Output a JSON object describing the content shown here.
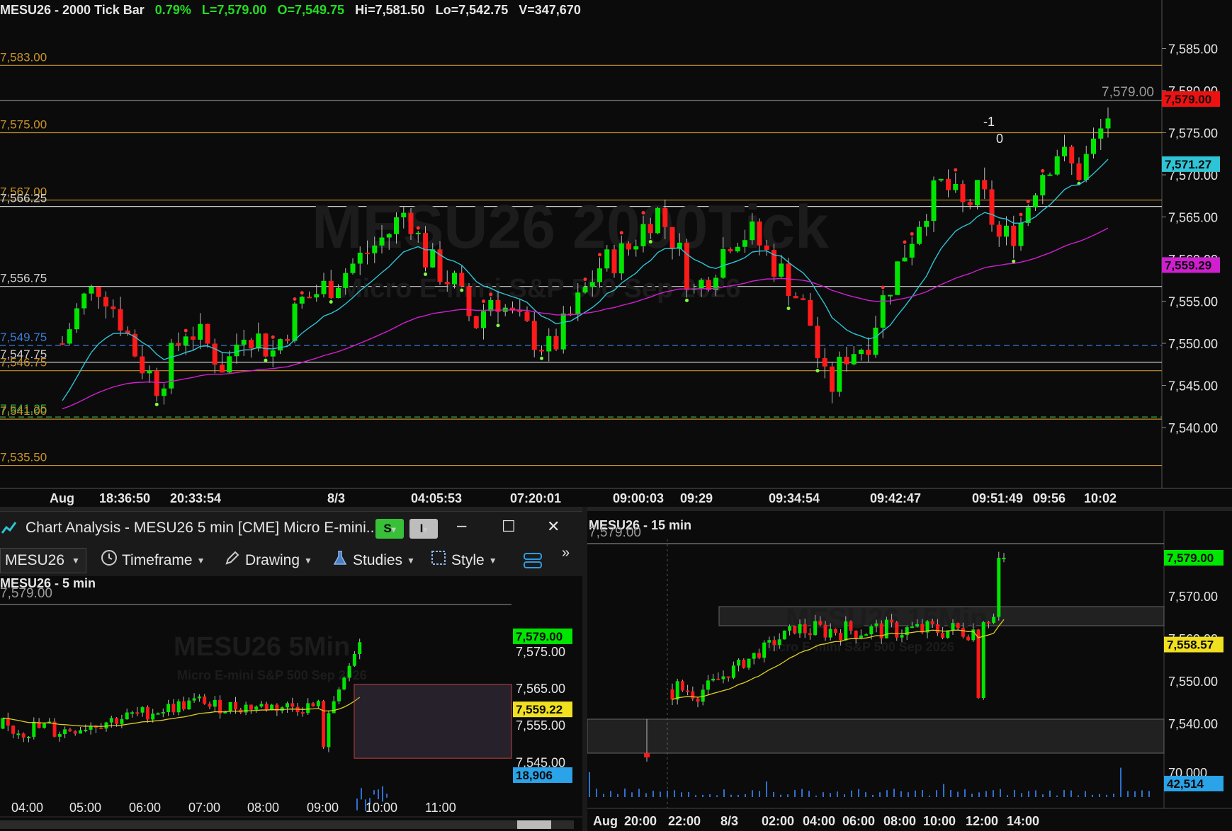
{
  "main_chart": {
    "symbol": "MESU26 - 2000 Tick Bar",
    "change": "0.79%",
    "last": "L=7,579.00",
    "open": "O=7,549.75",
    "high": "Hi=7,581.50",
    "low": "Lo=7,542.75",
    "volume": "V=347,670",
    "watermark_big": "MESU26 2000Tick",
    "watermark_small": "Micro E-mini S&P 500 Sep 2026",
    "y_ticks": [
      "7,585.00",
      "7,580.00",
      "7,575.00",
      "7,570.00",
      "7,565.00",
      "7,560.00",
      "7,555.00",
      "7,550.00",
      "7,545.00",
      "7,540.00"
    ],
    "x_ticks": [
      "Aug",
      "18:36:50",
      "20:33:54",
      "8/3",
      "04:05:53",
      "07:20:01",
      "09:00:03",
      "09:29",
      "09:34:54",
      "09:42:47",
      "09:51:49",
      "09:56",
      "10:02"
    ],
    "level_labels": [
      "7,583.00",
      "7,575.00",
      "7,567.00",
      "7,566.25",
      "7,556.75",
      "7,549.75",
      "7,547.75",
      "7,546.75",
      "7,541.25",
      "7,541.00",
      "7,535.50"
    ],
    "last_price_tag": "7,579.00",
    "last_price_ghost": "7,579.00",
    "ema_fast_tag": "7,571.27",
    "ema_slow_tag": "7,559.29",
    "order_marks": [
      "-1",
      "0"
    ]
  },
  "chart_analysis_window": {
    "title": "Chart Analysis - MESU26 5 min [CME] Micro E-mini...",
    "btn_s": "S",
    "btn_i": "I",
    "minimize": "‒",
    "maximize": "☐",
    "close": "✕",
    "symbol_select": "MESU26",
    "toolbar": {
      "timeframe": "Timeframe",
      "drawing": "Drawing",
      "studies": "Studies",
      "style": "Style",
      "more": "»"
    }
  },
  "chart_5min": {
    "title": "MESU26 - 5 min",
    "ghost_price": "7,579.00",
    "watermark": "MESU26 5Min",
    "watermark_small": "Micro E-mini S&P 500 Sep 2026",
    "y_ticks": [
      "7,575.00",
      "7,565.00",
      "7,555.00",
      "7,545.00"
    ],
    "last_tag": "7,579.00",
    "ma_tag": "7,559.22",
    "volume_tag": "18,906",
    "x_ticks": [
      "04:00",
      "05:00",
      "06:00",
      "07:00",
      "08:00",
      "09:00",
      "10:00",
      "11:00"
    ]
  },
  "chart_15min": {
    "title": "MESU26 - 15 min",
    "ghost_price": "7,579.00",
    "watermark": "MESU26 15Min",
    "watermark_small": "Micro E-mini S&P 500 Sep 2026",
    "y_ticks": [
      "7,570.00",
      "7,560.00",
      "7,550.00",
      "7,540.00"
    ],
    "vol_tick": "70,000",
    "last_tag": "7,579.00",
    "ma_tag": "7,558.57",
    "volume_tag": "42,514",
    "x_ticks": [
      "Aug",
      "20:00",
      "22:00",
      "8/3",
      "02:00",
      "04:00",
      "06:00",
      "08:00",
      "10:00",
      "12:00",
      "14:00"
    ]
  },
  "colors": {
    "up": "#00e600",
    "down": "#ff1a1a",
    "level": "#c8922a",
    "cyan": "#2ec4d6",
    "magenta": "#d01fd0",
    "blue_dash": "#3a7bd5",
    "green_dash": "#2fb04a"
  }
}
